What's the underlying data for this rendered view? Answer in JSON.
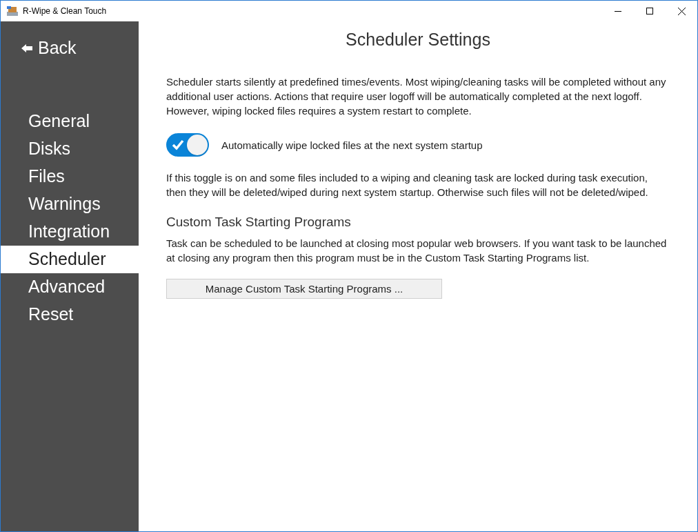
{
  "window": {
    "title": "R-Wipe & Clean Touch"
  },
  "sidebar": {
    "back": "Back",
    "items": [
      {
        "label": "General",
        "selected": false
      },
      {
        "label": "Disks",
        "selected": false
      },
      {
        "label": "Files",
        "selected": false
      },
      {
        "label": "Warnings",
        "selected": false
      },
      {
        "label": "Integration",
        "selected": false
      },
      {
        "label": "Scheduler",
        "selected": true
      },
      {
        "label": "Advanced",
        "selected": false
      },
      {
        "label": "Reset",
        "selected": false
      }
    ]
  },
  "page": {
    "title": "Scheduler Settings",
    "intro": "Scheduler starts silently at predefined times/events. Most wiping/cleaning tasks will be completed without any additional user actions. Actions that require user logoff will be automatically completed at the next logoff. However, wiping locked files requires a system restart to complete.",
    "toggle": {
      "label": "Automatically wipe locked files at the next system startup",
      "on": true
    },
    "toggle_note": "If this toggle is on and some files included to a wiping and cleaning task are locked during task execution, then they will be deleted/wiped during next system startup. Otherwise such files will not be deleted/wiped.",
    "section_title": "Custom Task Starting Programs",
    "section_text": "Task can be scheduled to be launched at closing most popular web browsers. If you want task to be launched at closing any program then this program must be in the Custom Task Starting Programs list.",
    "button": "Manage Custom Task Starting Programs ..."
  }
}
